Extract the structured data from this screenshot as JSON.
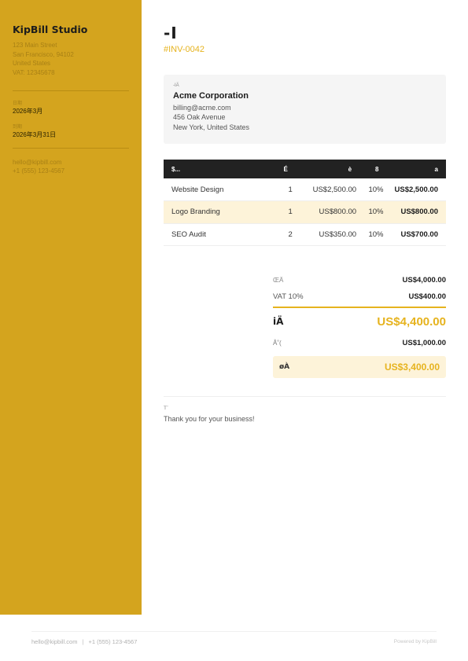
{
  "sidebar": {
    "company": "KipBill Studio",
    "address": [
      "123 Main Street",
      "San Francisco, 94102",
      "United States",
      "VAT: 12345678"
    ],
    "issue_date_label": "日期",
    "issue_date": "2026年3月",
    "due_date_label": "到期",
    "due_date": "2026年3月31日",
    "email": "hello@kipbill.com",
    "phone": "+1 (555) 123-4567"
  },
  "invoice": {
    "title": "-I",
    "number": "#INV-0042"
  },
  "bill_to": {
    "label": "-IÄ",
    "name": "Acme Corporation",
    "email": "billing@acme.com",
    "address1": "456 Oak Avenue",
    "address2": "New York, United States"
  },
  "table": {
    "headers": {
      "desc": "$...",
      "qty": "É",
      "price": "è",
      "tax": "8",
      "total": "a"
    },
    "rows": [
      {
        "desc": "Website Design",
        "qty": "1",
        "price": "US$2,500.00",
        "tax": "10%",
        "total": "US$2,500.00"
      },
      {
        "desc": "Logo Branding",
        "qty": "1",
        "price": "US$800.00",
        "tax": "10%",
        "total": "US$800.00"
      },
      {
        "desc": "SEO Audit",
        "qty": "2",
        "price": "US$350.00",
        "tax": "10%",
        "total": "US$700.00"
      }
    ]
  },
  "totals": {
    "subtotal_label": "ŒÄ",
    "subtotal": "US$4,000.00",
    "vat_label": "VAT 10%",
    "vat": "US$400.00",
    "total_label": "iÄ",
    "total": "US$4,400.00",
    "paid_label": "Â˚(",
    "paid": "US$1,000.00",
    "balance_label": "øÀ",
    "balance": "US$3,400.00"
  },
  "notes": {
    "label": "T¨",
    "text": "Thank you for your business!"
  },
  "footer": {
    "email": "hello@kipbill.com",
    "separator": "|",
    "phone": "+1 (555) 123-4567",
    "powered": "Powered by KipBill"
  },
  "colors": {
    "sidebar": "#d4a41e",
    "accent": "#e6b31e",
    "header": "#222222",
    "highlight": "#fdf3d9"
  }
}
